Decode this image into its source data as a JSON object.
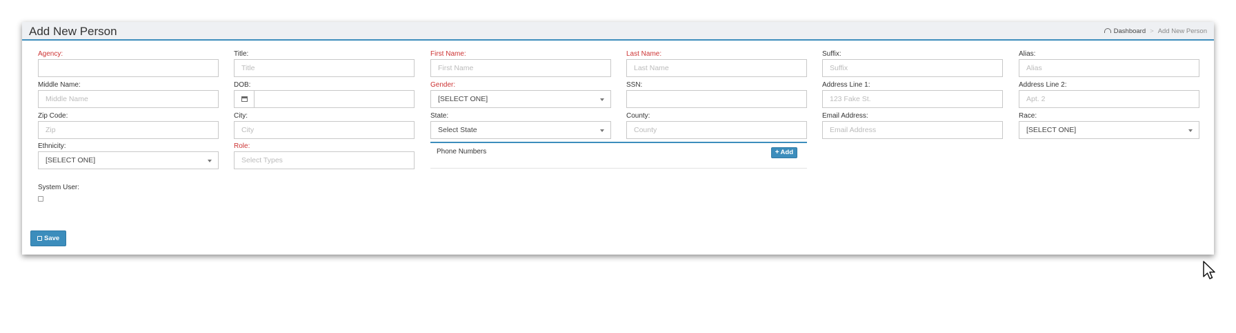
{
  "page": {
    "title": "Add New Person",
    "breadcrumb": {
      "dashboard": "Dashboard",
      "current": "Add New Person"
    }
  },
  "fields": {
    "agency": {
      "label": "Agency:",
      "value": "",
      "placeholder": ""
    },
    "title": {
      "label": "Title:",
      "placeholder": "Title"
    },
    "first_name": {
      "label": "First Name:",
      "placeholder": "First Name"
    },
    "last_name": {
      "label": "Last Name:",
      "placeholder": "Last Name"
    },
    "suffix": {
      "label": "Suffix:",
      "placeholder": "Suffix"
    },
    "alias": {
      "label": "Alias:",
      "placeholder": "Alias"
    },
    "middle_name": {
      "label": "Middle Name:",
      "placeholder": "Middle Name"
    },
    "dob": {
      "label": "DOB:",
      "value": ""
    },
    "gender": {
      "label": "Gender:",
      "selected": "[SELECT ONE]"
    },
    "ssn": {
      "label": "SSN:",
      "value": ""
    },
    "address1": {
      "label": "Address Line 1:",
      "placeholder": "123 Fake St."
    },
    "address2": {
      "label": "Address Line 2:",
      "placeholder": "Apt. 2"
    },
    "zip": {
      "label": "Zip Code:",
      "placeholder": "Zip"
    },
    "city": {
      "label": "City:",
      "placeholder": "City"
    },
    "state": {
      "label": "State:",
      "selected": "Select State"
    },
    "county": {
      "label": "County:",
      "placeholder": "County"
    },
    "email": {
      "label": "Email Address:",
      "placeholder": "Email Address"
    },
    "race": {
      "label": "Race:",
      "selected": "[SELECT ONE]"
    },
    "ethnicity": {
      "label": "Ethnicity:",
      "selected": "[SELECT ONE]"
    },
    "role": {
      "label": "Role:",
      "placeholder": "Select Types"
    },
    "system_user": {
      "label": "System User:",
      "checked": false
    }
  },
  "phone_numbers": {
    "title": "Phone Numbers",
    "add_label": "Add"
  },
  "actions": {
    "save_label": "Save"
  },
  "colors": {
    "accent": "#3c8dbc",
    "required": "#cc3333",
    "header_bg": "#eef0f3"
  },
  "icons": {
    "breadcrumb": "dashboard-icon",
    "dob": "calendar-icon",
    "add": "plus-icon",
    "save": "floppy-disk-icon",
    "pointer": "mouse-cursor-icon"
  }
}
